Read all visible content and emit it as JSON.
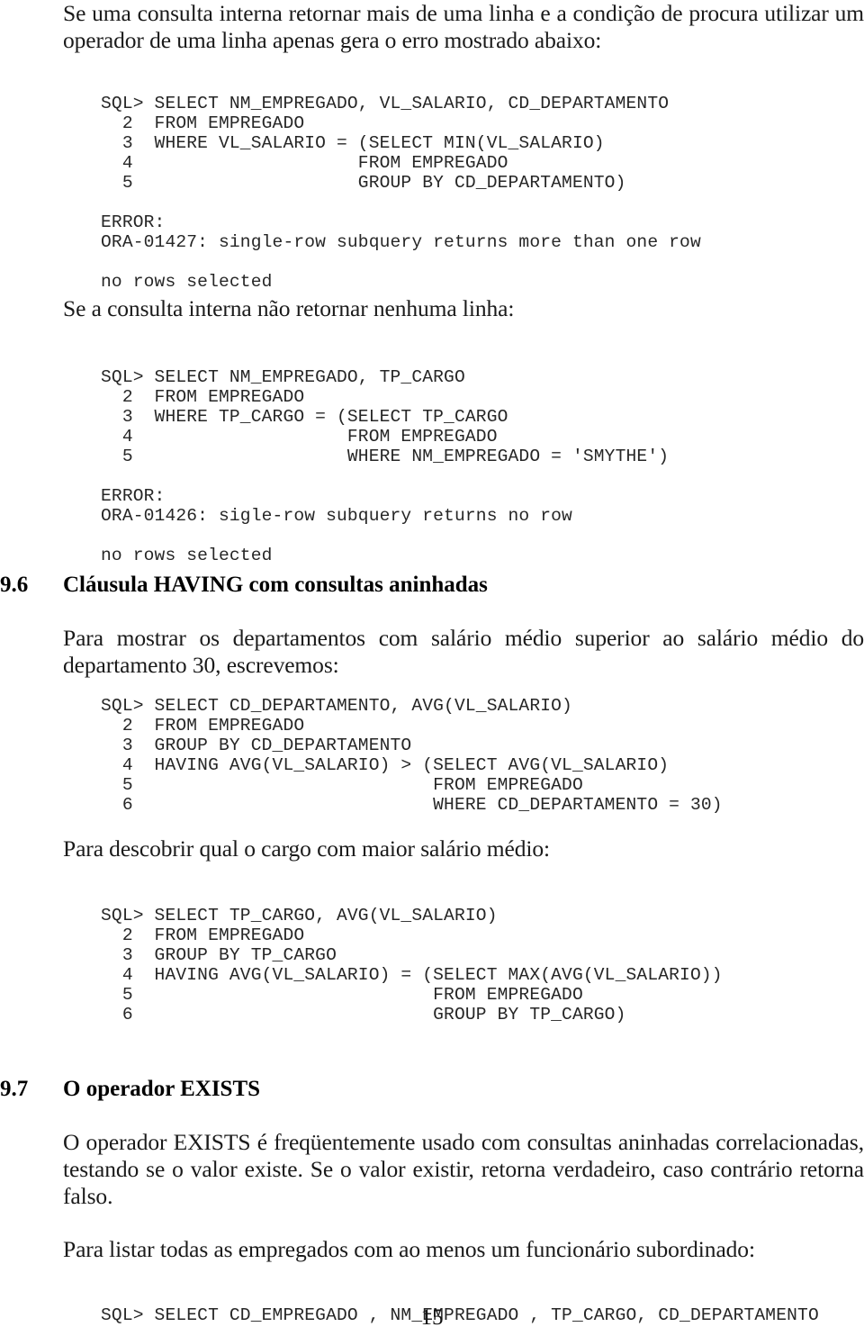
{
  "document": {
    "page_number": "15"
  },
  "blocks": {
    "intro_paragraph": "Se uma consulta interna retornar mais de uma linha e a condição de procura utilizar um operador de uma linha apenas gera o erro mostrado abaixo:",
    "lead_no_rows": "Se a consulta interna não retornar nenhuma linha:",
    "having_intro": "Para mostrar os departamentos com salário médio superior ao salário médio do departamento 30, escrevemos:",
    "max_avg_intro": "Para descobrir qual o cargo com maior salário médio:",
    "exists_paragraph": "O operador EXISTS é freqüentemente usado com consultas aninhadas correlacionadas, testando se o valor existe. Se o valor existir, retorna verdadeiro, caso contrário retorna falso.",
    "exists_example_intro": "Para listar todas as empregados com ao menos um funcionário subordinado:"
  },
  "sections": {
    "having": {
      "number": "9.6",
      "title": "Cláusula HAVING com consultas aninhadas"
    },
    "exists": {
      "number": "9.7",
      "title": "O operador EXISTS"
    }
  },
  "code_blocks": {
    "multi_row_error": "SQL> SELECT NM_EMPREGADO, VL_SALARIO, CD_DEPARTAMENTO\n  2  FROM EMPREGADO\n  3  WHERE VL_SALARIO = (SELECT MIN(VL_SALARIO)\n  4                     FROM EMPREGADO\n  5                     GROUP BY CD_DEPARTAMENTO)\n\nERROR:\nORA-01427: single-row subquery returns more than one row\n\nno rows selected",
    "no_row_error": "SQL> SELECT NM_EMPREGADO, TP_CARGO\n  2  FROM EMPREGADO\n  3  WHERE TP_CARGO = (SELECT TP_CARGO\n  4                    FROM EMPREGADO\n  5                    WHERE NM_EMPREGADO = 'SMYTHE')\n\nERROR:\nORA-01426: sigle-row subquery returns no row\n\nno rows selected",
    "having_avg": "SQL> SELECT CD_DEPARTAMENTO, AVG(VL_SALARIO)\n  2  FROM EMPREGADO\n  3  GROUP BY CD_DEPARTAMENTO\n  4  HAVING AVG(VL_SALARIO) > (SELECT AVG(VL_SALARIO)\n  5                            FROM EMPREGADO\n  6                            WHERE CD_DEPARTAMENTO = 30)",
    "having_max_avg": "SQL> SELECT TP_CARGO, AVG(VL_SALARIO)\n  2  FROM EMPREGADO\n  3  GROUP BY TP_CARGO\n  4  HAVING AVG(VL_SALARIO) = (SELECT MAX(AVG(VL_SALARIO))\n  5                            FROM EMPREGADO\n  6                            GROUP BY TP_CARGO)",
    "exists_example": "SQL> SELECT CD_EMPREGADO , NM_EMPREGADO , TP_CARGO, CD_DEPARTAMENTO"
  }
}
